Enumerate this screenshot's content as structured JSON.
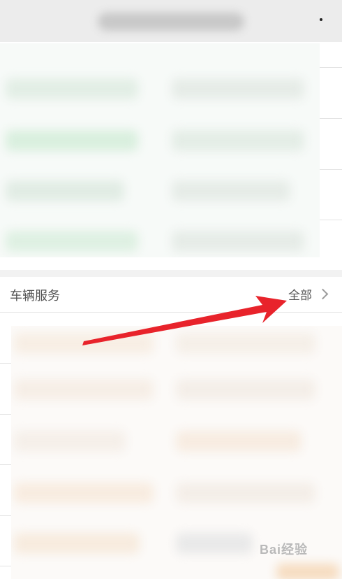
{
  "vehicle_service": {
    "title": "车辆服务",
    "more_label": "全部"
  },
  "watermark": "Bai经验",
  "colors": {
    "arrow": "#e8232b",
    "top_tint": "#e9f6ec",
    "bottom_tint": "#fdf3e6"
  },
  "icons": [
    "chevron-right-icon",
    "arrow-annotation-icon",
    "baidu-paw-icon"
  ]
}
